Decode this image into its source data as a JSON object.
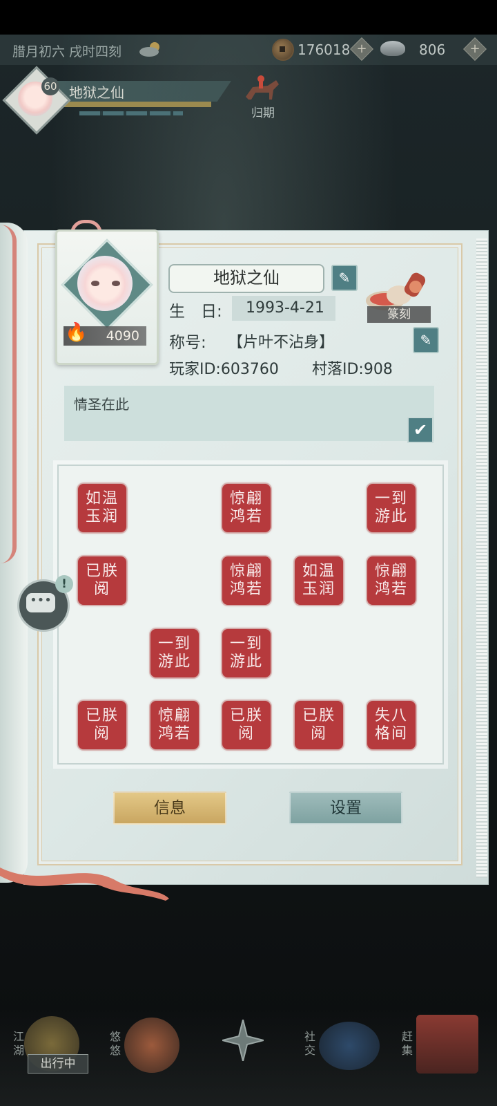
{
  "status_bar": {
    "date_time": "腊月初六  戌时四刻",
    "copper_coins": "176018",
    "silver": "806",
    "weather_icon": "cloud-sun-icon"
  },
  "player": {
    "level": "60",
    "name": "地狱之仙",
    "return_label": "归期"
  },
  "profile": {
    "power": "4090",
    "name": "地狱之仙",
    "birthday_label": "生　日:",
    "birthday_value": "1993-4-21",
    "title_label": "称号:",
    "title_value": "【片叶不沾身】",
    "player_id": "玩家ID:603760",
    "village_id": "村落ID:908",
    "carve_label": "篆刻",
    "signature": "情圣在此"
  },
  "seals": {
    "items": [
      {
        "l1": "如温",
        "l2": "玉润"
      },
      {
        "l1": "惊翩",
        "l2": "鸿若"
      },
      {
        "l1": "一到",
        "l2": "游此"
      },
      {
        "l1": "已朕",
        "l2": "阅"
      },
      {
        "l1": "惊翩",
        "l2": "鸿若"
      },
      {
        "l1": "如温",
        "l2": "玉润"
      },
      {
        "l1": "惊翩",
        "l2": "鸿若"
      },
      {
        "l1": "一到",
        "l2": "游此"
      },
      {
        "l1": "一到",
        "l2": "游此"
      },
      {
        "l1": "已朕",
        "l2": "阅"
      },
      {
        "l1": "惊翩",
        "l2": "鸿若"
      },
      {
        "l1": "已朕",
        "l2": "阅"
      },
      {
        "l1": "已朕",
        "l2": "阅"
      },
      {
        "l1": "失八",
        "l2": "格间"
      }
    ]
  },
  "buttons": {
    "info": "信息",
    "settings": "设置"
  },
  "chat": {
    "alert": "!"
  },
  "bottom_nav": {
    "jianghu": "江湖",
    "youyou": "悠悠",
    "shejiao": "社交",
    "ganji": "赶集",
    "status": "出行中"
  },
  "colors": {
    "seal_red": "#b63a3d",
    "info_gold": "#d9bc78",
    "settings_teal": "#8fb0af"
  }
}
